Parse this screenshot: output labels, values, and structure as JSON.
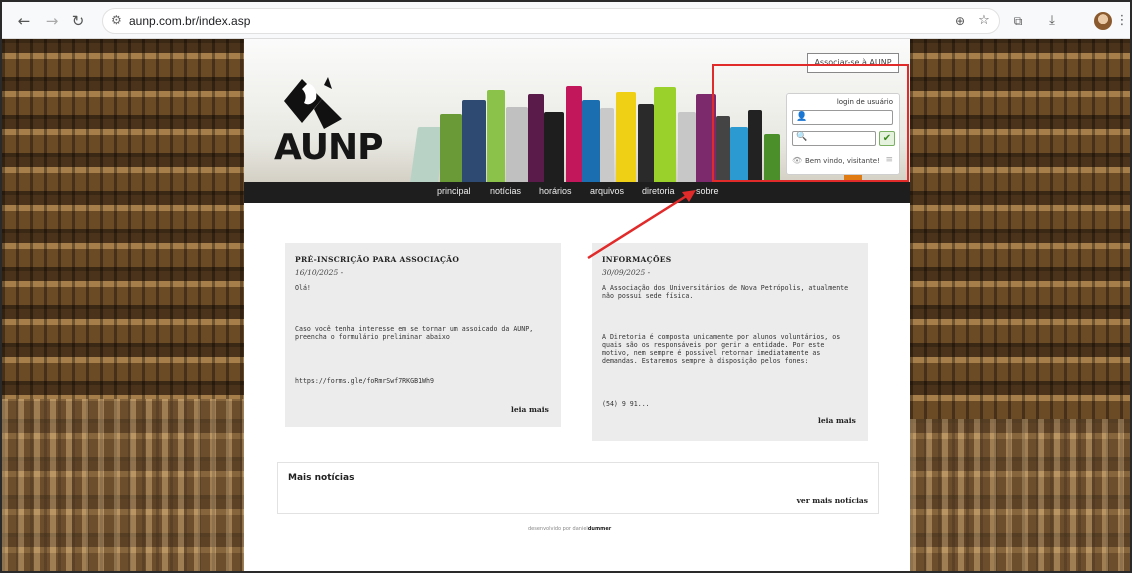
{
  "browser": {
    "url": "aunp.com.br/index.asp",
    "back_icon": "back-arrow-icon",
    "forward_icon": "forward-arrow-icon",
    "reload_icon": "reload-icon"
  },
  "header": {
    "logo_text": "AUNP",
    "associate_button": "Associar-se à AUNP",
    "login": {
      "title": "login de usuário",
      "user_placeholder": "",
      "password_placeholder": "",
      "welcome": "Bem vindo, visitante!"
    }
  },
  "nav": {
    "items": [
      "principal",
      "notícias",
      "horários",
      "arquivos",
      "diretoria",
      "sobre"
    ]
  },
  "news": [
    {
      "title": "PRÉ-INSCRIÇÃO PARA ASSOCIAÇÃO",
      "date": "16/10/2025 -",
      "p1": "Olá!",
      "p2": "Caso você tenha interesse em se tornar um assoicado da AUNP, preencha o formulário preliminar abaixo",
      "p3": "https://forms.gle/foRmrSwf7RKGB1Wh9",
      "more": "leia mais"
    },
    {
      "title": "INFORMAÇÕES",
      "date": "30/09/2025 -",
      "p1": "A Associação dos Universitários de Nova Petrópolis, atualmente não possui sede física.",
      "p2": "A Diretoria é composta unicamente por alunos voluntários, os quais são os responsáveis por gerir a entidade. Por este motivo, nem sempre é possível retornar imediatamente as demandas. Estaremos sempre à disposição pelos fones:",
      "p3": "(54) 9 91...",
      "more": "leia mais"
    }
  ],
  "more_news": {
    "title": "Mais notícias",
    "link": "ver mais notícias"
  },
  "footer": {
    "prefix": "desenvolvido por daniel",
    "author": "dummer"
  },
  "colors": {
    "highlight": "#e12a2a",
    "navbar": "#1e1e1e",
    "card": "#ececec"
  }
}
